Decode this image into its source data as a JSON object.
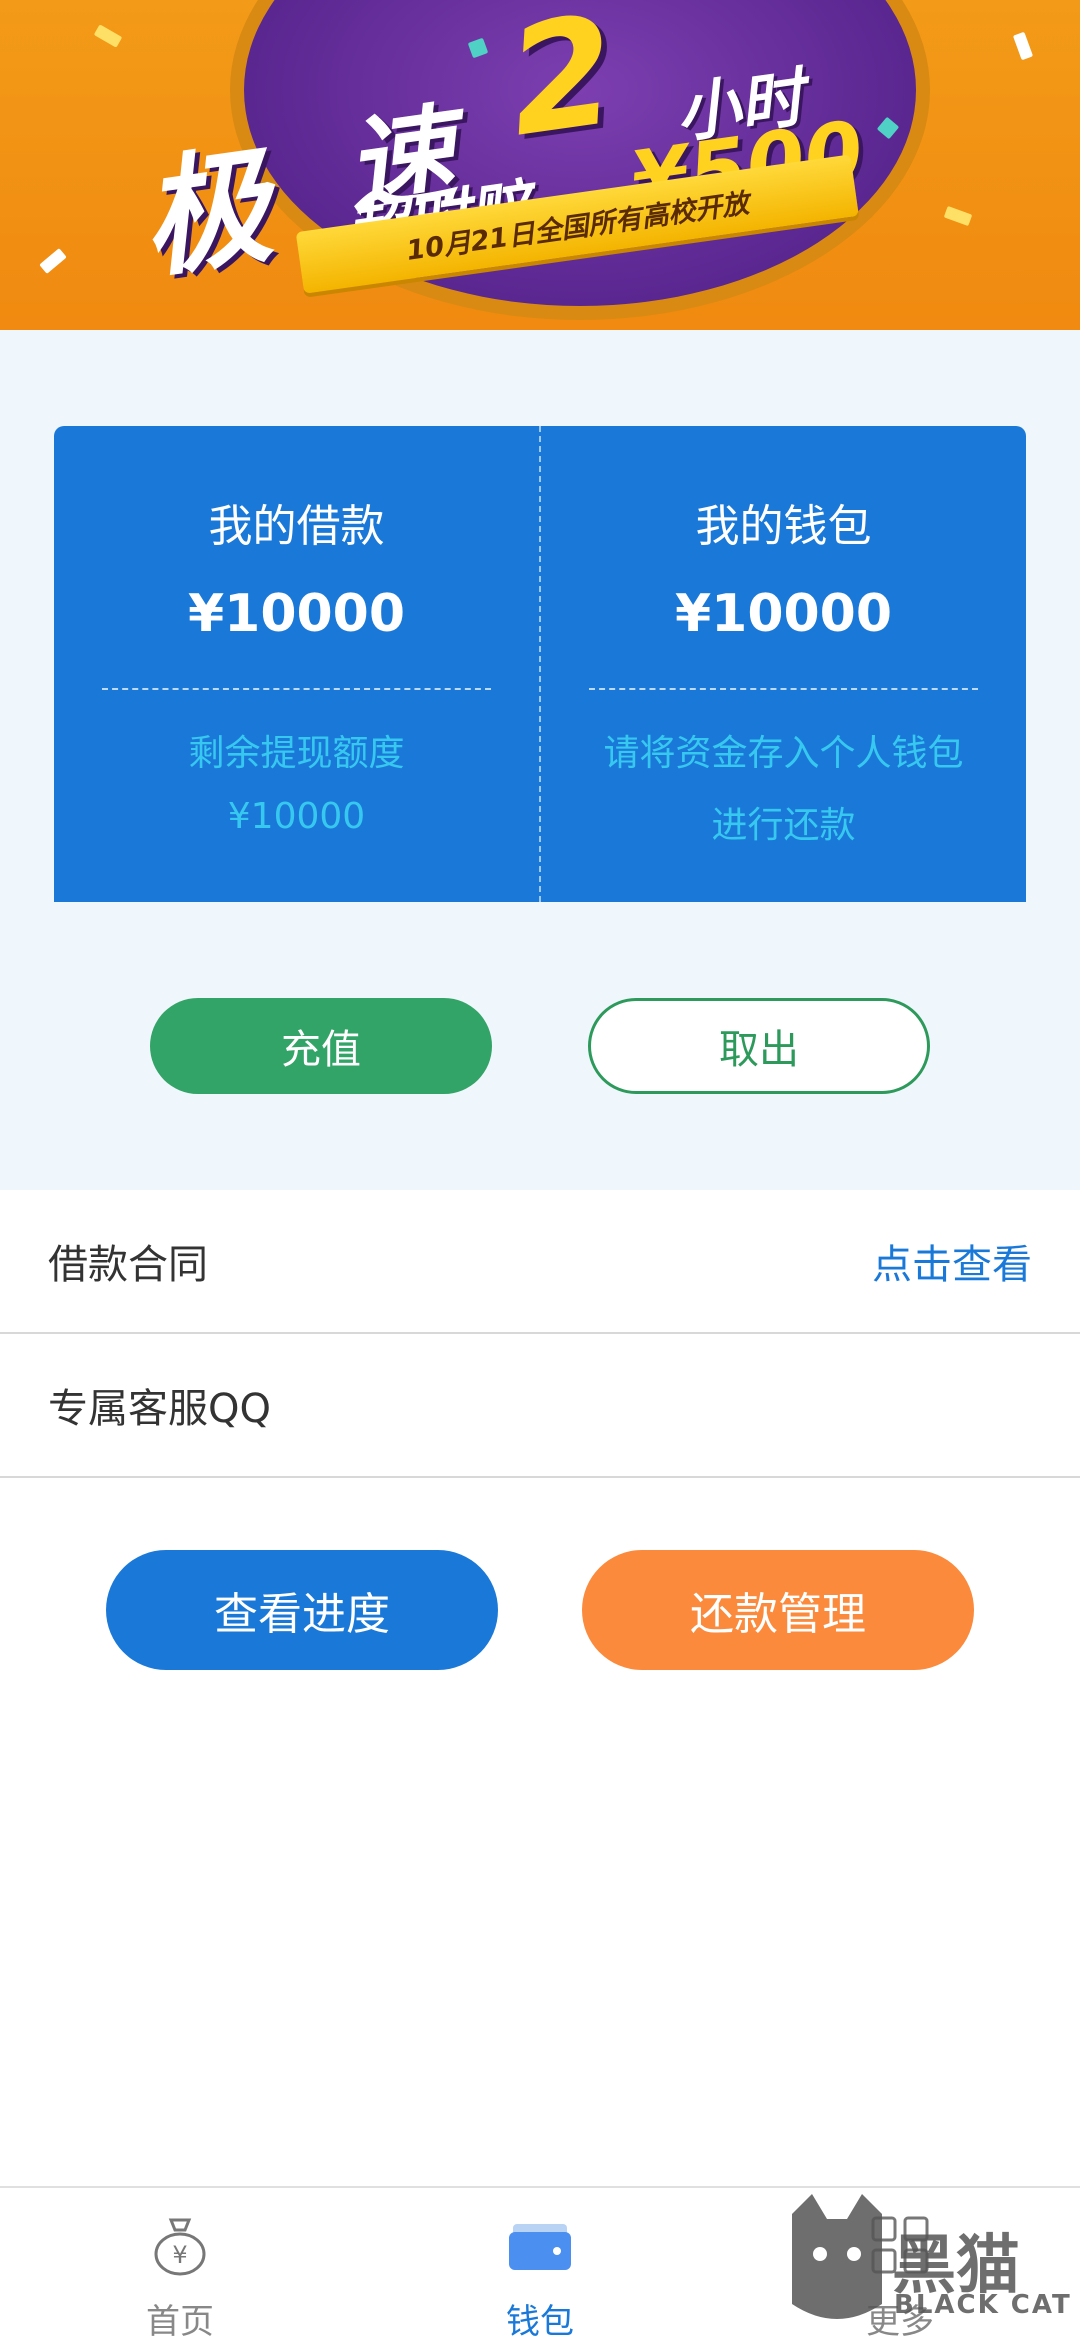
{
  "banner": {
    "word1": "极",
    "word2": "速",
    "number": "2",
    "hours": "小时",
    "compensation": "超时赔",
    "amount": "¥500",
    "ribbon": "10月21日全国所有高校开放"
  },
  "wallet_card": {
    "loan": {
      "title": "我的借款",
      "amount": "¥10000",
      "sub_label": "剩余提现额度",
      "sub_value": "¥10000"
    },
    "wallet": {
      "title": "我的钱包",
      "amount": "¥10000",
      "line1": "请将资金存入个人钱包",
      "line2": "进行还款"
    }
  },
  "actions": {
    "recharge": "充值",
    "withdraw": "取出"
  },
  "rows": {
    "contract_label": "借款合同",
    "contract_action": "点击查看",
    "qq_label": "专属客服QQ"
  },
  "bottom_buttons": {
    "progress": "查看进度",
    "repay": "还款管理"
  },
  "tabbar": {
    "items": [
      {
        "label": "首页",
        "icon": "money-bag-icon"
      },
      {
        "label": "钱包",
        "icon": "wallet-icon"
      },
      {
        "label": "更多",
        "icon": "grid-icon"
      }
    ]
  },
  "watermark": {
    "text": "黑猫",
    "sub": "BLACK CAT"
  },
  "colors": {
    "primary": "#1a79d8",
    "green": "#33a467",
    "orange": "#fb8a3c",
    "cyan_text": "#37c8f0"
  }
}
